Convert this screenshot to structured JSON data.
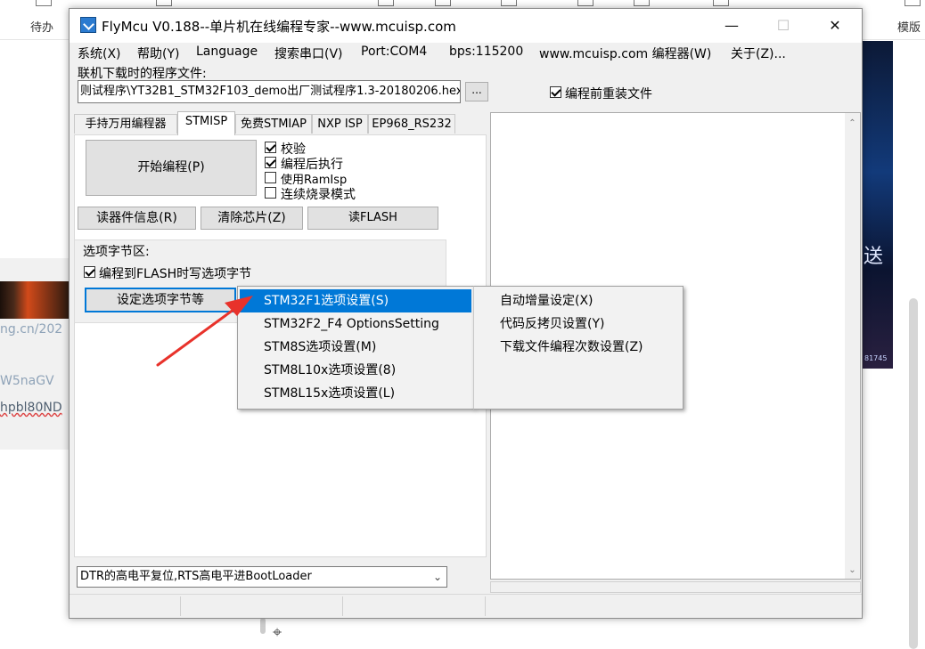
{
  "background_app": {
    "left_label": "待办",
    "right_label": "模版",
    "left_texts": [
      "ng.cn/202",
      "W5naGV",
      "hpbl80ND"
    ],
    "right_text": "送",
    "right_small": "81745"
  },
  "window": {
    "title": "FlyMcu V0.188--单片机在线编程专家--www.mcuisp.com",
    "controls": {
      "minimize": "—",
      "maximize": "☐",
      "close": "✕"
    }
  },
  "menubar": [
    "系统(X)",
    "帮助(Y)",
    "Language",
    "搜索串口(V)",
    "Port:COM4",
    "bps:115200",
    "www.mcuisp.com 编程器(W)",
    "关于(Z)..."
  ],
  "file": {
    "label": "联机下载时的程序文件:",
    "path": "则试程序\\YT32B1_STM32F103_demo出厂测试程序1.3-20180206.hex",
    "browse": "...",
    "reload_label": "编程前重装文件",
    "reload_checked": true
  },
  "tabs": [
    "手持万用编程器",
    "STMISP",
    "免费STMIAP",
    "NXP ISP",
    "EP968_RS232"
  ],
  "active_tab": "STMISP",
  "stmisp": {
    "start_button": "开始编程(P)",
    "options": [
      {
        "label": "校验",
        "checked": true
      },
      {
        "label": "编程后执行",
        "checked": true
      },
      {
        "label": "使用RamIsp",
        "checked": false
      },
      {
        "label": "连续烧录模式",
        "checked": false
      }
    ],
    "read_info": "读器件信息(R)",
    "erase_chip": "清除芯片(Z)",
    "read_flash": "读FLASH",
    "option_group": {
      "title": "选项字节区:",
      "write_option": "编程到FLASH时写选项字节",
      "write_option_checked": true,
      "set_button": "设定选项字节等"
    }
  },
  "bootloader_combo": "DTR的高电平复位,RTS高电平进BootLoader",
  "context_menu": {
    "left": [
      "STM32F1选项设置(S)",
      "STM32F2_F4 OptionsSetting",
      "STM8S选项设置(M)",
      "STM8L10x选项设置(8)",
      "STM8L15x选项设置(L)"
    ],
    "highlighted": "STM32F1选项设置(S)",
    "right": [
      "自动增量设定(X)",
      "代码反拷贝设置(Y)",
      "下载文件编程次数设置(Z)"
    ]
  },
  "colors": {
    "highlight": "#0078d7",
    "arrow": "#e8322b",
    "window_bg": "#f0f0f0"
  }
}
